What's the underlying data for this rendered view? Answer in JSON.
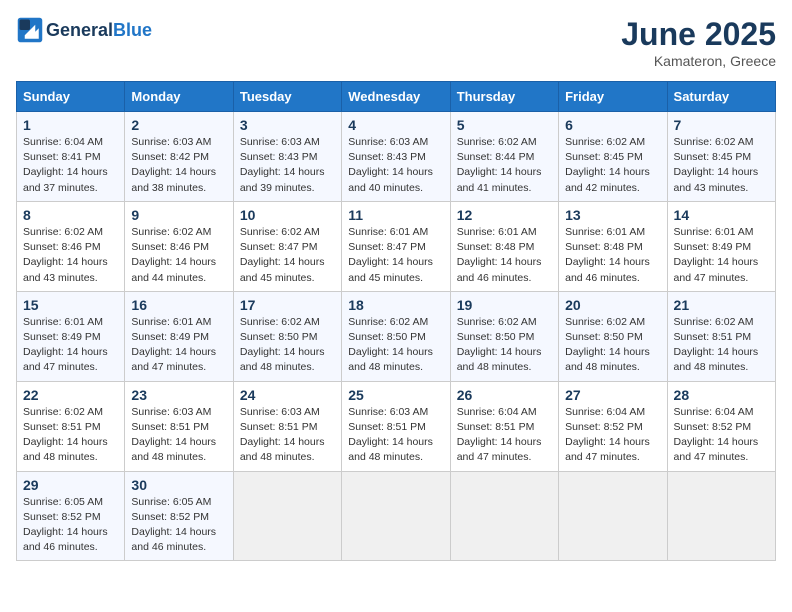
{
  "header": {
    "logo_general": "General",
    "logo_blue": "Blue",
    "month": "June 2025",
    "location": "Kamateron, Greece"
  },
  "weekdays": [
    "Sunday",
    "Monday",
    "Tuesday",
    "Wednesday",
    "Thursday",
    "Friday",
    "Saturday"
  ],
  "weeks": [
    [
      {
        "day": "1",
        "info": "Sunrise: 6:04 AM\nSunset: 8:41 PM\nDaylight: 14 hours\nand 37 minutes."
      },
      {
        "day": "2",
        "info": "Sunrise: 6:03 AM\nSunset: 8:42 PM\nDaylight: 14 hours\nand 38 minutes."
      },
      {
        "day": "3",
        "info": "Sunrise: 6:03 AM\nSunset: 8:43 PM\nDaylight: 14 hours\nand 39 minutes."
      },
      {
        "day": "4",
        "info": "Sunrise: 6:03 AM\nSunset: 8:43 PM\nDaylight: 14 hours\nand 40 minutes."
      },
      {
        "day": "5",
        "info": "Sunrise: 6:02 AM\nSunset: 8:44 PM\nDaylight: 14 hours\nand 41 minutes."
      },
      {
        "day": "6",
        "info": "Sunrise: 6:02 AM\nSunset: 8:45 PM\nDaylight: 14 hours\nand 42 minutes."
      },
      {
        "day": "7",
        "info": "Sunrise: 6:02 AM\nSunset: 8:45 PM\nDaylight: 14 hours\nand 43 minutes."
      }
    ],
    [
      {
        "day": "8",
        "info": "Sunrise: 6:02 AM\nSunset: 8:46 PM\nDaylight: 14 hours\nand 43 minutes."
      },
      {
        "day": "9",
        "info": "Sunrise: 6:02 AM\nSunset: 8:46 PM\nDaylight: 14 hours\nand 44 minutes."
      },
      {
        "day": "10",
        "info": "Sunrise: 6:02 AM\nSunset: 8:47 PM\nDaylight: 14 hours\nand 45 minutes."
      },
      {
        "day": "11",
        "info": "Sunrise: 6:01 AM\nSunset: 8:47 PM\nDaylight: 14 hours\nand 45 minutes."
      },
      {
        "day": "12",
        "info": "Sunrise: 6:01 AM\nSunset: 8:48 PM\nDaylight: 14 hours\nand 46 minutes."
      },
      {
        "day": "13",
        "info": "Sunrise: 6:01 AM\nSunset: 8:48 PM\nDaylight: 14 hours\nand 46 minutes."
      },
      {
        "day": "14",
        "info": "Sunrise: 6:01 AM\nSunset: 8:49 PM\nDaylight: 14 hours\nand 47 minutes."
      }
    ],
    [
      {
        "day": "15",
        "info": "Sunrise: 6:01 AM\nSunset: 8:49 PM\nDaylight: 14 hours\nand 47 minutes."
      },
      {
        "day": "16",
        "info": "Sunrise: 6:01 AM\nSunset: 8:49 PM\nDaylight: 14 hours\nand 47 minutes."
      },
      {
        "day": "17",
        "info": "Sunrise: 6:02 AM\nSunset: 8:50 PM\nDaylight: 14 hours\nand 48 minutes."
      },
      {
        "day": "18",
        "info": "Sunrise: 6:02 AM\nSunset: 8:50 PM\nDaylight: 14 hours\nand 48 minutes."
      },
      {
        "day": "19",
        "info": "Sunrise: 6:02 AM\nSunset: 8:50 PM\nDaylight: 14 hours\nand 48 minutes."
      },
      {
        "day": "20",
        "info": "Sunrise: 6:02 AM\nSunset: 8:50 PM\nDaylight: 14 hours\nand 48 minutes."
      },
      {
        "day": "21",
        "info": "Sunrise: 6:02 AM\nSunset: 8:51 PM\nDaylight: 14 hours\nand 48 minutes."
      }
    ],
    [
      {
        "day": "22",
        "info": "Sunrise: 6:02 AM\nSunset: 8:51 PM\nDaylight: 14 hours\nand 48 minutes."
      },
      {
        "day": "23",
        "info": "Sunrise: 6:03 AM\nSunset: 8:51 PM\nDaylight: 14 hours\nand 48 minutes."
      },
      {
        "day": "24",
        "info": "Sunrise: 6:03 AM\nSunset: 8:51 PM\nDaylight: 14 hours\nand 48 minutes."
      },
      {
        "day": "25",
        "info": "Sunrise: 6:03 AM\nSunset: 8:51 PM\nDaylight: 14 hours\nand 48 minutes."
      },
      {
        "day": "26",
        "info": "Sunrise: 6:04 AM\nSunset: 8:51 PM\nDaylight: 14 hours\nand 47 minutes."
      },
      {
        "day": "27",
        "info": "Sunrise: 6:04 AM\nSunset: 8:52 PM\nDaylight: 14 hours\nand 47 minutes."
      },
      {
        "day": "28",
        "info": "Sunrise: 6:04 AM\nSunset: 8:52 PM\nDaylight: 14 hours\nand 47 minutes."
      }
    ],
    [
      {
        "day": "29",
        "info": "Sunrise: 6:05 AM\nSunset: 8:52 PM\nDaylight: 14 hours\nand 46 minutes."
      },
      {
        "day": "30",
        "info": "Sunrise: 6:05 AM\nSunset: 8:52 PM\nDaylight: 14 hours\nand 46 minutes."
      },
      {
        "day": "",
        "info": ""
      },
      {
        "day": "",
        "info": ""
      },
      {
        "day": "",
        "info": ""
      },
      {
        "day": "",
        "info": ""
      },
      {
        "day": "",
        "info": ""
      }
    ]
  ]
}
